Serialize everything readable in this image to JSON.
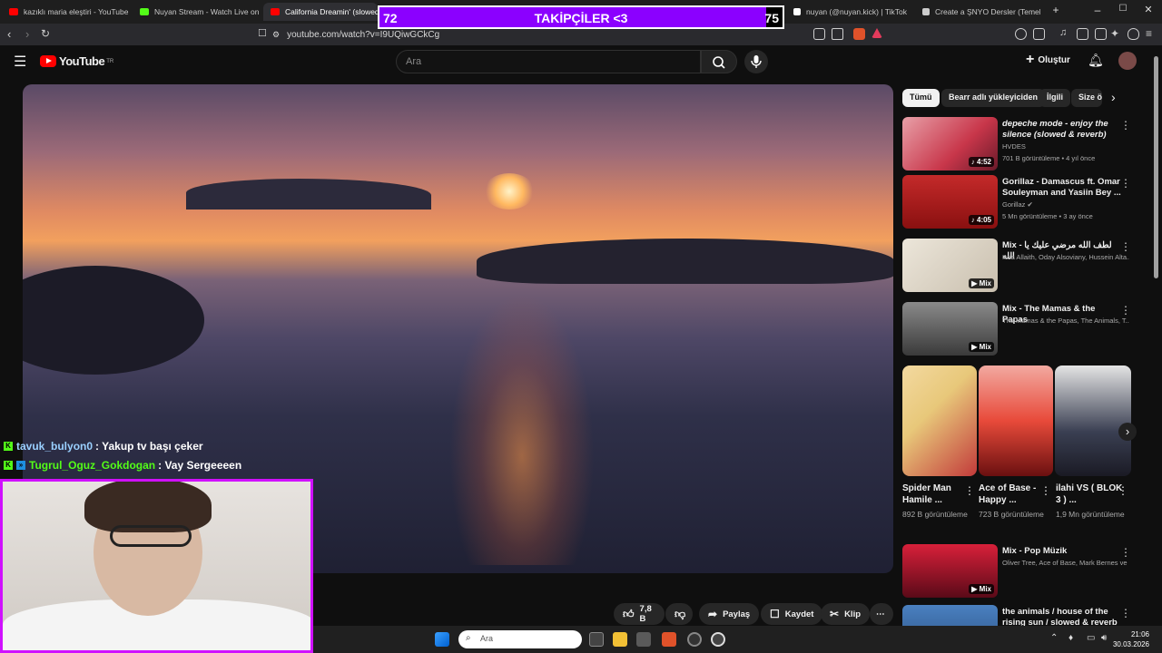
{
  "browser": {
    "tabs": [
      {
        "label": "kazıklı maria eleştiri - YouTube",
        "color": "#ff0000"
      },
      {
        "label": "Nuyan Stream - Watch Live on Ki",
        "color": "#53fc18"
      },
      {
        "label": "California Dreamin' (slowed",
        "color": "#ff0000"
      },
      {
        "label": "nuyan (@nuyan.kick) | TikTok",
        "color": "#ffffff"
      },
      {
        "label": "Create a ŞNYO Dersler (Temel) Tir",
        "color": "#cccccc"
      }
    ],
    "url": "youtube.com/watch?v=I9UQiwGCkCg",
    "new_tab": "+",
    "window_controls": [
      "–",
      "☐",
      "✕"
    ]
  },
  "overlay": {
    "label": "TAKİPÇİLER <3",
    "current": "72",
    "goal": "75",
    "progress_fraction": 0.96,
    "bar_color": "#8b00ff"
  },
  "youtube": {
    "logo": "YouTube",
    "region": "TR",
    "search_placeholder": "Ara",
    "create_label": "Oluştur"
  },
  "chat": [
    {
      "user": "tavuk_bulyon0",
      "message": ": Yakup tv başı çeker",
      "user_color": "#9ad0ff"
    },
    {
      "user": "Tugrul_Oguz_Gokdogan",
      "message": ": Vay Sergeeeen",
      "user_color": "#53fc18"
    }
  ],
  "actions": {
    "like_count": "7,8 B",
    "share": "Paylaş",
    "save": "Kaydet",
    "clip": "Klip",
    "more": "⋯"
  },
  "chips": [
    "Tümü",
    "Bearr adlı yükleyiciden",
    "İlgili",
    "Size ö"
  ],
  "recommendations": [
    {
      "title": "depeche mode - enjoy the silence (slowed & reverb)",
      "channel": "HVDES",
      "stats": "701 B görüntüleme • 4 yıl önce",
      "badge": "♪ 4:52",
      "thumb_color": "#c8364a"
    },
    {
      "title": "Gorillaz - Damascus ft. Omar Souleyman and Yasiin Bey ...",
      "channel": "Gorillaz ✔",
      "stats": "5 Mn görüntüleme • 3 ay önce",
      "badge": "♪ 4:05",
      "thumb_color": "#b81d1d"
    },
    {
      "title": "Mix - لطف الله مرضي عليك يا الله",
      "channel": "Issa Allaith, Oday Alsoviany, Hussein Alta...",
      "stats": "",
      "badge": "▶ Mix",
      "thumb_color": "#d8d0c4"
    },
    {
      "title": "Mix - The Mamas & the Papas",
      "channel": "The Mamas & the Papas, The Animals, T...",
      "stats": "",
      "badge": "▶ Mix",
      "thumb_color": "#6b6b6b"
    }
  ],
  "shorts": [
    {
      "title": "Spider Man Hamile ...",
      "views": "892 B görüntüleme",
      "color": "#e8c87a"
    },
    {
      "title": "Ace of Base - Happy ...",
      "views": "723 B görüntüleme",
      "color": "#e84a3a"
    },
    {
      "title": "ilahi VS ( BLOK 3 ) ...",
      "views": "1,9 Mn görüntüleme",
      "color": "#3a3f52"
    }
  ],
  "more_recs": [
    {
      "title": "Mix - Pop Müzik",
      "channel": "Oliver Tree, Ace of Base, Mark Bernes ve ...",
      "badge": "▶ Mix",
      "thumb_color": "#b0102a"
    },
    {
      "title": "the animals / house of the rising sun / slowed & reverb ...",
      "channel": "",
      "badge": "",
      "thumb_color": "#3a6fb0"
    }
  ],
  "taskbar": {
    "search_placeholder": "Ara",
    "time": "21:06",
    "date": "30.03.2026"
  }
}
